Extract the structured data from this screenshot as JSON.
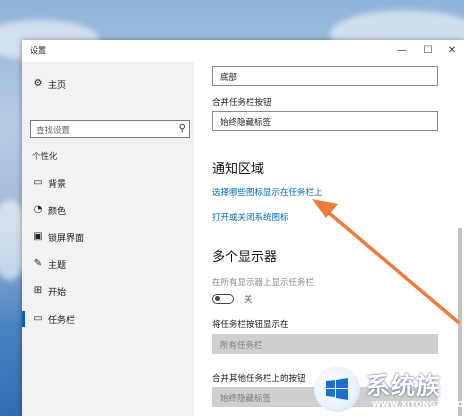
{
  "window": {
    "title": "设置",
    "controls": {
      "minimize": "—",
      "maximize": "☐",
      "close": "✕"
    }
  },
  "sidebar": {
    "home_label": "主页",
    "search_placeholder": "查找设置",
    "section_title": "个性化",
    "items": [
      {
        "label": "背景",
        "icon": "image-icon"
      },
      {
        "label": "颜色",
        "icon": "palette-icon"
      },
      {
        "label": "锁屏界面",
        "icon": "lock-screen-icon"
      },
      {
        "label": "主题",
        "icon": "theme-icon"
      },
      {
        "label": "开始",
        "icon": "start-icon"
      },
      {
        "label": "任务栏",
        "icon": "taskbar-icon",
        "active": true
      }
    ]
  },
  "content": {
    "position_dropdown_value": "底部",
    "combine_label": "合并任务栏按钮",
    "combine_value": "始终隐藏标签",
    "notify_heading": "通知区域",
    "notify_link1": "选择哪些图标显示在任务栏上",
    "notify_link2": "打开或关闭系统图标",
    "multi_heading": "多个显示器",
    "show_all_label": "在所有显示器上显示任务栏",
    "toggle_state": "关",
    "show_buttons_label": "将任务栏按钮显示在",
    "show_buttons_value": "所有任务栏",
    "combine_other_label": "合并其他任务栏上的按钮",
    "combine_other_value": "始终隐藏标签"
  },
  "watermark": {
    "title": "系统族",
    "subtitle": "WWW.XITONGZU.COM"
  },
  "colors": {
    "accent": "#0063b1",
    "link": "#0067b8",
    "arrow": "#f07a3c"
  }
}
